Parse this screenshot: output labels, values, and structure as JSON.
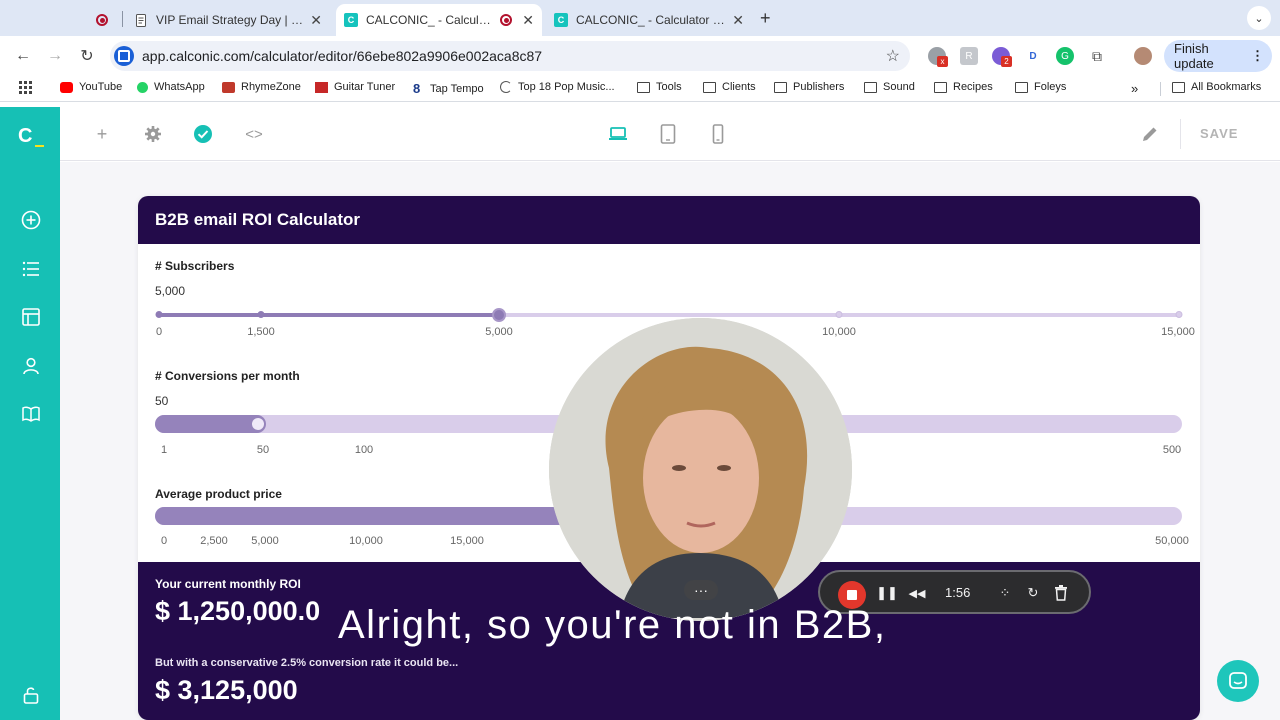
{
  "browser": {
    "tabs": [
      {
        "title": "",
        "favicon": "record-icon",
        "active": false
      },
      {
        "title": "VIP Email Strategy Day | Ethic",
        "favicon": "google-docs-icon",
        "active": false
      },
      {
        "title": "CALCONIC_ - Calculator I",
        "favicon": "calconic-icon",
        "active": true
      },
      {
        "title": "CALCONIC_ - Calculator Buil",
        "favicon": "calconic-icon",
        "active": false
      }
    ],
    "url": "app.calconic.com/calculator/editor/66ebe802a9906e002aca8c87",
    "finish_update": "Finish update",
    "extension_badge": "2",
    "bookmarks": [
      {
        "label": "YouTube",
        "icon": "youtube-icon"
      },
      {
        "label": "WhatsApp",
        "icon": "whatsapp-icon"
      },
      {
        "label": "RhymeZone",
        "icon": "rhymezone-icon"
      },
      {
        "label": "Guitar Tuner",
        "icon": "guitar-tuner-icon"
      },
      {
        "label": "Tap Tempo",
        "icon": "tap-tempo-icon"
      },
      {
        "label": "Top 18 Pop Music...",
        "icon": "loading-icon"
      },
      {
        "label": "Tools",
        "icon": "folder-icon"
      },
      {
        "label": "Clients",
        "icon": "folder-icon"
      },
      {
        "label": "Publishers",
        "icon": "folder-icon"
      },
      {
        "label": "Sound",
        "icon": "folder-icon"
      },
      {
        "label": "Recipes",
        "icon": "folder-icon"
      },
      {
        "label": "Foleys",
        "icon": "folder-icon"
      }
    ],
    "all_bookmarks": "All Bookmarks"
  },
  "app": {
    "logo": "C",
    "save": "SAVE",
    "accent": "#16c0b5",
    "header_color": "#230b4a"
  },
  "calculator": {
    "title": "B2B email ROI Calculator",
    "subscribers": {
      "label": "# Subscribers",
      "value": "5,000",
      "fraction": 0.3333,
      "ticks": [
        "0",
        "1,500",
        "5,000",
        "10,000",
        "15,000"
      ]
    },
    "conversions": {
      "label": "# Conversions per month",
      "value": "50",
      "fraction": 0.1,
      "ticks": [
        "1",
        "50",
        "100",
        "500"
      ]
    },
    "price": {
      "label": "Average product price",
      "ticks": [
        "0",
        "2,500",
        "5,000",
        "10,000",
        "15,000",
        "50,000"
      ]
    },
    "current_roi_label": "Your current monthly ROI",
    "current_roi_value": "$ 1,250,000.0",
    "conservative_label": "But with a conservative 2.5% conversion rate it could be...",
    "conservative_value": "$ 3,125,000"
  },
  "recorder": {
    "time": "1:56"
  },
  "caption": "Alright, so you're not in B2B,"
}
